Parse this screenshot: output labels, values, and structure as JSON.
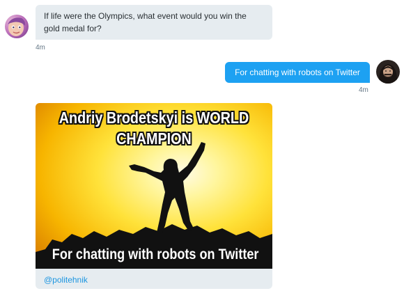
{
  "conversation": {
    "messages": [
      {
        "sender": "bot",
        "avatar_icon": "cartoon-face-avatar",
        "text": "If life were the Olympics, what event would you win the gold medal for?",
        "timestamp": "4m"
      },
      {
        "sender": "user",
        "avatar_icon": "bearded-man-avatar",
        "text": "For chatting with robots on Twitter",
        "timestamp": "4m"
      }
    ],
    "media_card": {
      "image_icon": "champion-silhouette-image",
      "top_caption": "Andriy Brodetskyi is WORLD CHAMPION",
      "bottom_caption": "For chatting with robots on Twitter",
      "handle": "@politehnik"
    }
  },
  "colors": {
    "incoming_bubble": "#e6ecf0",
    "outgoing_bubble": "#1da1f2",
    "link": "#1b95e0",
    "timestamp": "#657786"
  }
}
